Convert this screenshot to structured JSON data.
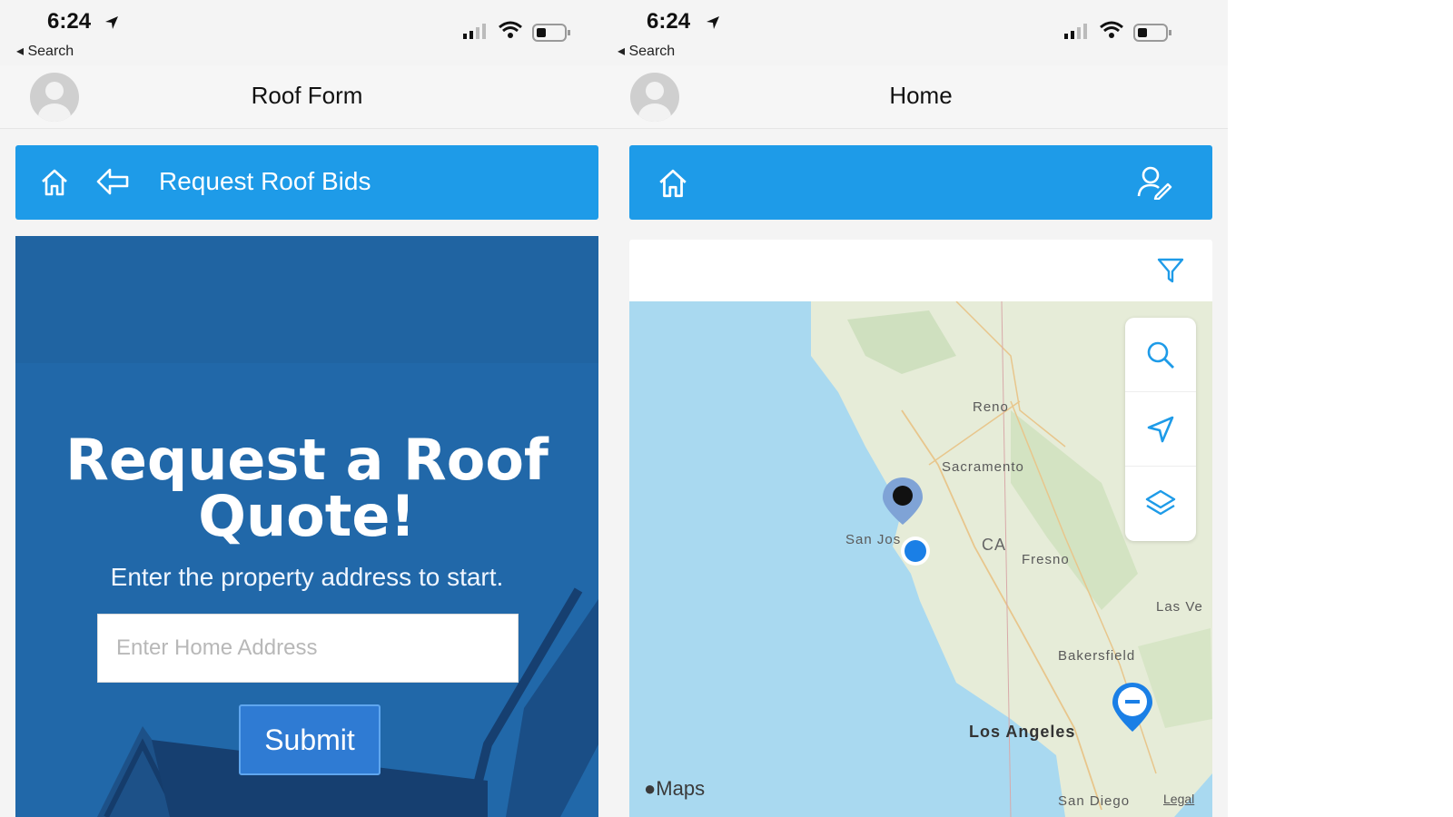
{
  "left_screen": {
    "status": {
      "time": "6:24",
      "back_label": "◂ Search"
    },
    "nav": {
      "title": "Roof Form"
    },
    "toolbar": {
      "title": "Request Roof Bids"
    },
    "hero": {
      "title_line1": "Request a Roof",
      "title_line2": "Quote!",
      "subtitle": "Enter the property address to start.",
      "address_placeholder": "Enter Home Address",
      "submit_label": "Submit"
    }
  },
  "right_screen": {
    "status": {
      "time": "6:24",
      "back_label": "◂ Search"
    },
    "nav": {
      "title": "Home"
    },
    "map": {
      "labels": {
        "reno": "Reno",
        "sacramento": "Sacramento",
        "san_jose": "San Jos",
        "ca": "CA",
        "fresno": "Fresno",
        "las_vegas": "Las Ve",
        "bakersfield": "Bakersfield",
        "los_angeles": "Los Angeles",
        "san_diego": "San Diego"
      },
      "attribution": "Maps",
      "legal": "Legal"
    }
  },
  "colors": {
    "toolbar_blue": "#1e9be8",
    "hero_blue": "#2168a9",
    "map_water": "#a9d9f0",
    "map_land": "#e9eedd",
    "pin_blue": "#1a7fe6"
  },
  "icons": [
    "location-arrow-icon",
    "signal-icon",
    "wifi-icon",
    "battery-icon",
    "home-icon",
    "back-arrow-icon",
    "user-edit-icon",
    "filter-icon",
    "search-icon",
    "navigate-icon",
    "layers-icon",
    "map-pin-icon",
    "apple-logo-icon"
  ]
}
